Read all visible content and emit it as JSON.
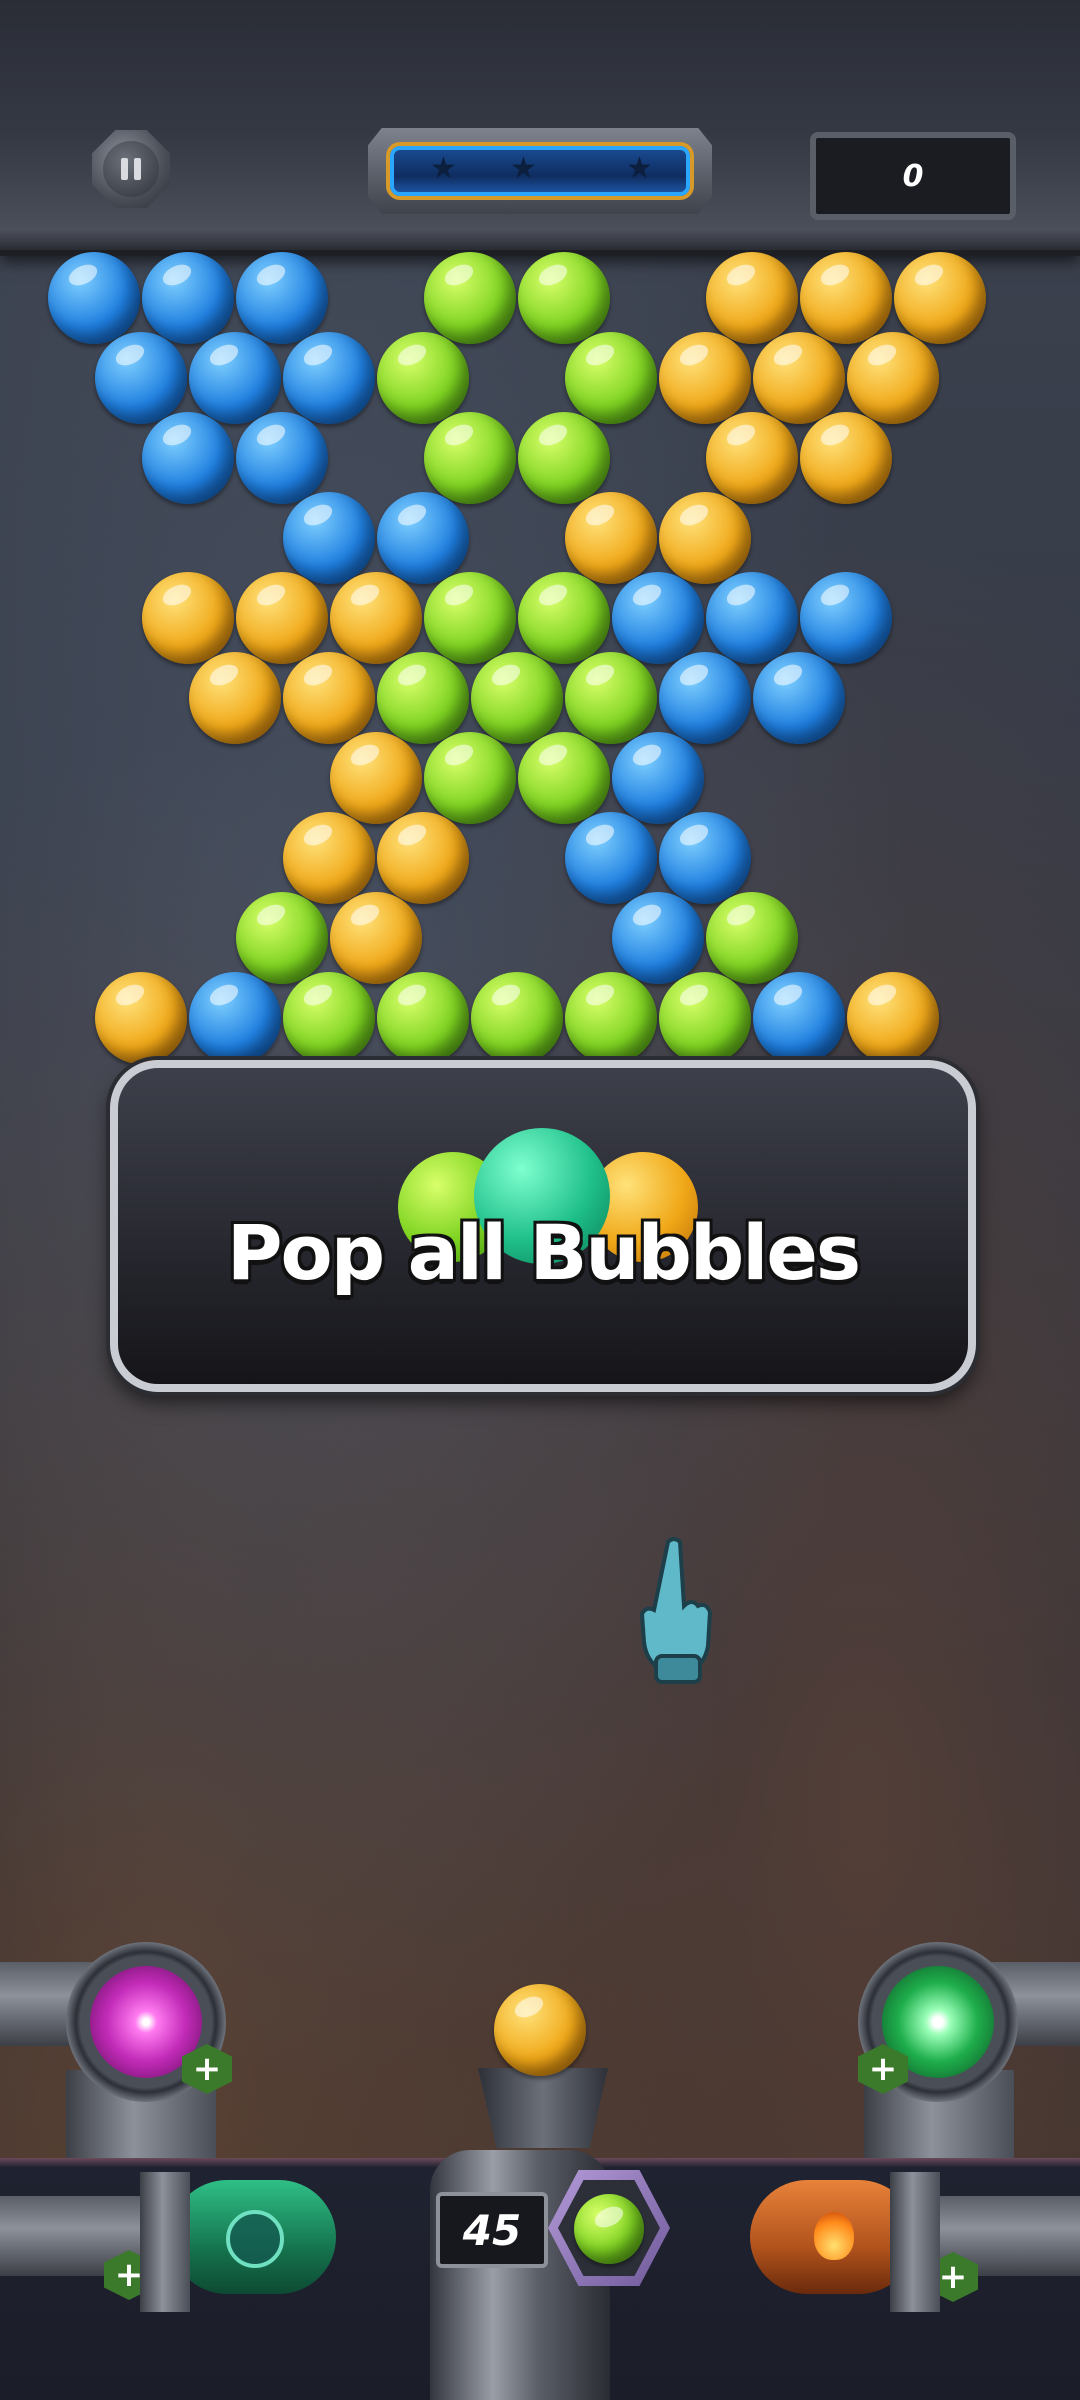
{
  "hud": {
    "score": "0",
    "stars_total": 3,
    "moves_left": "45"
  },
  "banner": {
    "text": "Pop all Bubbles"
  },
  "boosters": {
    "top_left": {
      "name": "laser-booster",
      "color": "#d63ccf"
    },
    "top_right": {
      "name": "lightning-booster",
      "color": "#1fae4c"
    },
    "bottom_left": {
      "name": "bubble-booster",
      "color": "#1b8a60"
    },
    "bottom_right": {
      "name": "fire-booster",
      "color": "#c0561a"
    }
  },
  "shooter": {
    "current_bubble": "yellow",
    "next_bubble": "green"
  },
  "colors": {
    "blue": "#1f7fe0",
    "green": "#7ed321",
    "yellow": "#f0a818"
  },
  "grid": [
    [
      "B",
      "B",
      "B",
      "-",
      "G",
      "G",
      "-",
      "Y",
      "Y",
      "Y"
    ],
    [
      "B",
      "B",
      "B",
      "G",
      "-",
      "G",
      "Y",
      "Y",
      "Y",
      "-"
    ],
    [
      "-",
      "B",
      "B",
      "-",
      "G",
      "G",
      "-",
      "Y",
      "Y",
      "-"
    ],
    [
      "-",
      "-",
      "B",
      "B",
      "-",
      "Y",
      "Y",
      "-",
      "-",
      "-"
    ],
    [
      "-",
      "Y",
      "Y",
      "Y",
      "G",
      "G",
      "B",
      "B",
      "B",
      "-"
    ],
    [
      "-",
      "Y",
      "Y",
      "G",
      "G",
      "G",
      "B",
      "B",
      "-",
      "-"
    ],
    [
      "-",
      "-",
      "-",
      "Y",
      "G",
      "G",
      "B",
      "-",
      "-",
      "-"
    ],
    [
      "-",
      "-",
      "Y",
      "Y",
      "-",
      "B",
      "B",
      "-",
      "-",
      "-"
    ],
    [
      "-",
      "-",
      "G",
      "Y",
      "-",
      "-",
      "B",
      "G",
      "-",
      "-"
    ],
    [
      "Y",
      "B",
      "G",
      "G",
      "G",
      "G",
      "G",
      "B",
      "Y",
      "-"
    ]
  ]
}
